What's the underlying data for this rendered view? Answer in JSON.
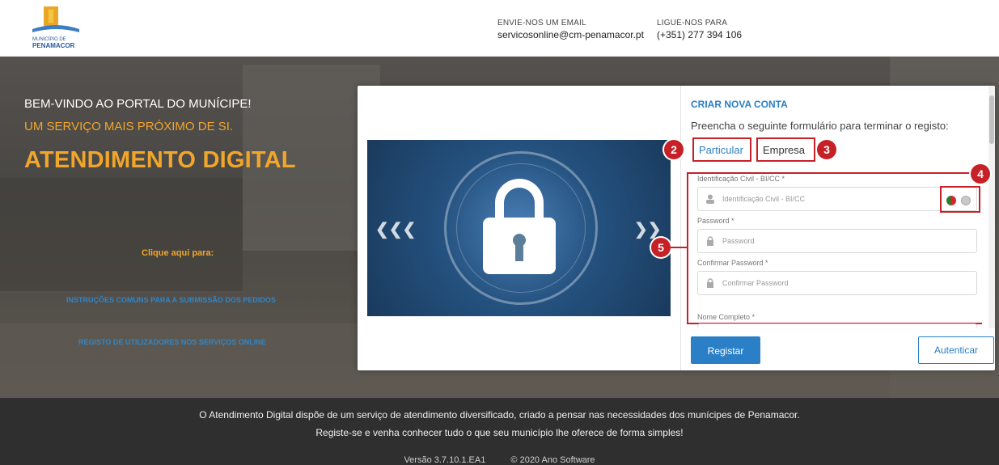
{
  "header": {
    "logo_text_line1": "MUNICÍPIO DE",
    "logo_text_line2": "PENAMACOR",
    "email_label": "ENVIE-NOS UM EMAIL",
    "email_value": "servicosonline@cm-penamacor.pt",
    "phone_label": "LIGUE-NOS PARA",
    "phone_value": "(+351) 277 394 106"
  },
  "hero": {
    "welcome": "BEM-VINDO AO PORTAL DO MUNÍCIPE!",
    "subtitle": "UM SERVIÇO MAIS PRÓXIMO DE SI.",
    "title": "ATENDIMENTO DIGITAL",
    "click_here": "Clique aqui para:",
    "link_instructions": "INSTRUÇÕES COMUNS PARA A SUBMISSÃO DOS PEDIDOS",
    "link_registration": "REGISTO DE UTILIZADORES NOS SERVIÇOS ONLINE"
  },
  "form": {
    "title": "CRIAR NOVA CONTA",
    "subtitle": "Preencha o seguinte formulário para terminar o registo:",
    "tab_particular": "Particular",
    "tab_empresa": "Empresa",
    "fields": [
      {
        "label": "Identificação Civil - BI/CC *",
        "placeholder": "Identificação Civil - BI/CC"
      },
      {
        "label": "Password *",
        "placeholder": "Password"
      },
      {
        "label": "Confirmar Password *",
        "placeholder": "Confirmar Password"
      },
      {
        "label": "Nome Completo *",
        "placeholder": ""
      }
    ],
    "register_button": "Registar",
    "auth_button": "Autenticar"
  },
  "badges": [
    "2",
    "3",
    "4",
    "5"
  ],
  "footer": {
    "line1": "O Atendimento Digital dispõe de um serviço de atendimento diversificado, criado a pensar nas necessidades dos munícipes de Penamacor.",
    "line2": "Registe-se e venha conhecer tudo o que seu município lhe oferece de forma simples!",
    "version": "Versão 3.7.10.1.EA1",
    "copyright": "© 2020  Ano Software"
  },
  "colors": {
    "accent": "#2a7fc6",
    "highlight": "#c62127",
    "orange": "#f1a62b",
    "footer_bg": "#2f2f2f"
  }
}
